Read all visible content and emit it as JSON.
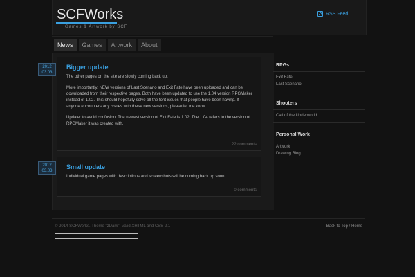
{
  "header": {
    "site_title": "SCFWorks",
    "tagline": "Games & Artwork by SCF",
    "rss_label": "RSS Feed"
  },
  "nav": {
    "tabs": [
      {
        "label": "News",
        "active": true
      },
      {
        "label": "Games",
        "active": false
      },
      {
        "label": "Artwork",
        "active": false
      },
      {
        "label": "About",
        "active": false
      }
    ]
  },
  "posts": [
    {
      "date_year": "2012",
      "date_md": "03.03",
      "title": "Bigger update",
      "paragraphs": [
        "The other pages on the site are slowly coming back up.",
        "More importantly, NEW versions of Last Scenario and Exit Fate have been uploaded and can be downloaded from their respective pages. Both have been updated to use the 1.04 version RPGMaker instead of 1.02. This should hopefully solve all the font issues that people have been having. If anyone  encounters any issues with these new versions, please let me know.",
        "Update: to avoid confusion. The newest version of Exit Fate is 1.02. The 1.04 refers to the version of RPGMaker it was created with."
      ],
      "comments": "22 comments"
    },
    {
      "date_year": "2012",
      "date_md": "03.03",
      "title": "Small update",
      "paragraphs": [
        "Individual game pages with descriptions and screenshots will be coming back up soon"
      ],
      "comments": "0 comments"
    }
  ],
  "sidebar": {
    "sections": [
      {
        "heading": "RPGs",
        "links": [
          "Exit Fate",
          "Last Scenario"
        ]
      },
      {
        "heading": "Shooters",
        "links": [
          "Call of the Underworld"
        ]
      },
      {
        "heading": "Personal Work",
        "links": [
          "Artwork",
          "Drawing Blog"
        ]
      }
    ]
  },
  "footer": {
    "copyright": "© 2014 SCFWorks. Theme \"zDark\". Valid XHTML and CSS 2.1",
    "back_to_top": "Back to Top",
    "separator": " / ",
    "home": "Home"
  },
  "colors": {
    "accent": "#3aa0e0",
    "background": "#121212"
  }
}
